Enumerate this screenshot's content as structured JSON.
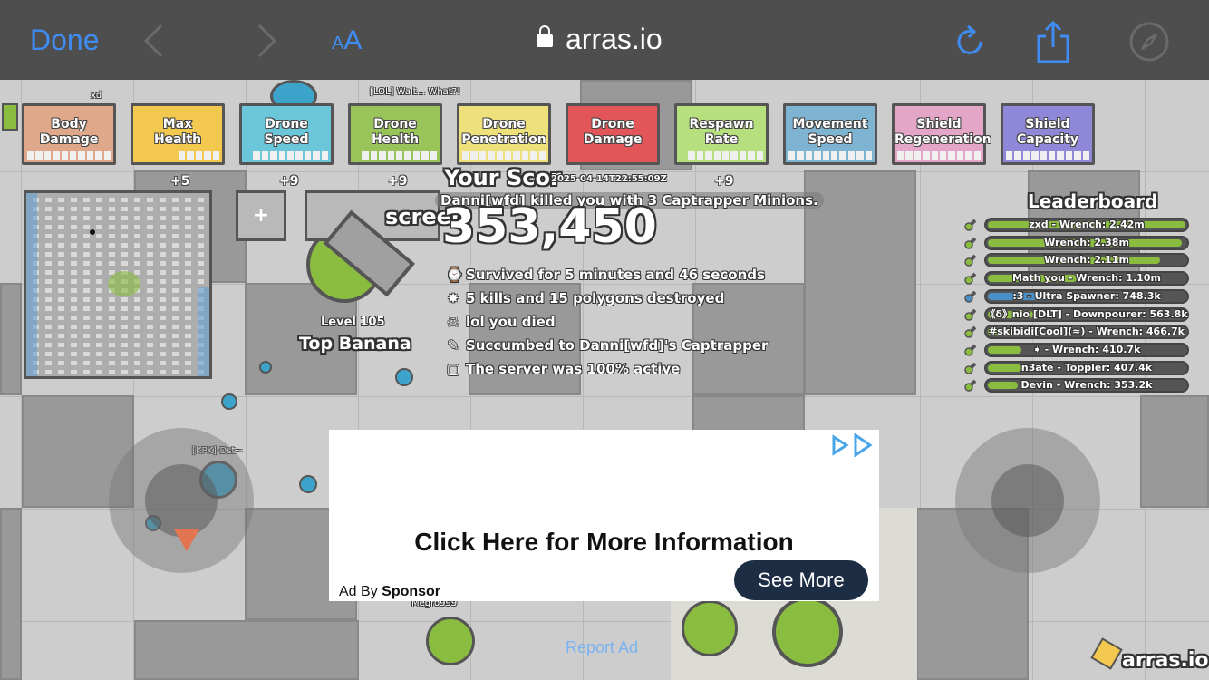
{
  "browser": {
    "done_label": "Done",
    "text_size_label_small": "A",
    "text_size_label_large": "A",
    "url": "arras.io",
    "accent_color": "#3f8cf2"
  },
  "stats": [
    {
      "label_1": "Body",
      "label_2": "Damage",
      "color": "#e0a88a",
      "filled": 0,
      "total": 10
    },
    {
      "label_1": "Max",
      "label_2": "Health",
      "color": "#f3c84e",
      "filled": 5,
      "total": 10,
      "plus": "+5"
    },
    {
      "label_1": "Drone",
      "label_2": "Speed",
      "color": "#6cc6da",
      "filled": 1,
      "total": 10,
      "plus": "+9"
    },
    {
      "label_1": "Drone",
      "label_2": "Health",
      "color": "#98c45a",
      "filled": 1,
      "total": 10,
      "plus": "+9"
    },
    {
      "label_1": "Drone",
      "label_2": "Penetration",
      "color": "#eee07a",
      "filled": 0,
      "total": 10
    },
    {
      "label_1": "Drone",
      "label_2": "Damage",
      "color": "#e25559",
      "filled": 10,
      "total": 10
    },
    {
      "label_1": "Respawn",
      "label_2": "Rate",
      "color": "#b6e07e",
      "filled": 1,
      "total": 10,
      "plus": "+9"
    },
    {
      "label_1": "Movement",
      "label_2": "Speed",
      "color": "#7eb3d2",
      "filled": 0,
      "total": 10
    },
    {
      "label_1": "Shield",
      "label_2": "Regeneration",
      "color": "#e3a6c6",
      "filled": 0,
      "total": 10
    },
    {
      "label_1": "Shield",
      "label_2": "Capacity",
      "color": "#8f87d8",
      "filled": 0,
      "total": 10
    }
  ],
  "death": {
    "score_label": "Your Scor",
    "timestamp": "2025-04-14T22:55:09Z",
    "killer_text": "Danni[wfd] killed you with 3 Captrapper Minions.",
    "score": "353,450",
    "lines": [
      {
        "icon": "stopwatch-icon",
        "glyph": "⌚",
        "text": "Survived for 5 minutes and 46 seconds"
      },
      {
        "icon": "explosion-icon",
        "glyph": "✸",
        "text": "5 kills and 15 polygons destroyed"
      },
      {
        "icon": "skull-icon",
        "glyph": "☠",
        "text": "lol you died"
      },
      {
        "icon": "knife-icon",
        "glyph": "✎",
        "text": "Succumbed to Danni[wfd]'s Captrapper"
      },
      {
        "icon": "clipboard-icon",
        "glyph": "▢",
        "text": "The server was 100% active"
      }
    ],
    "screenshot_label_fragment": "screen"
  },
  "player": {
    "level": "Level 105",
    "tank_name": "Top Banana"
  },
  "leaderboard": {
    "title": "Leaderboard",
    "entries": [
      {
        "text": "zxd - Wrench: 2.42m",
        "fill": 1.0,
        "color": "#8abc3f"
      },
      {
        "text": "Wrench: 2.38m",
        "fill": 0.98,
        "color": "#8abc3f"
      },
      {
        "text": "Wrench: 2.11m",
        "fill": 0.87,
        "color": "#8abc3f"
      },
      {
        "text": "Math you - Wrench: 1.10m",
        "fill": 0.45,
        "color": "#8abc3f"
      },
      {
        "text": ":3 - Ultra Spawner: 748.3k",
        "fill": 0.31,
        "color": "#4a90c8"
      },
      {
        "text": "《δ》nio [DLT] - Downpourer: 563.8k",
        "fill": 0.23,
        "color": "#8abc3f"
      },
      {
        "text": "#skibidi[Cool](≈) - Wrench: 466.7k",
        "fill": 0.19,
        "color": "#8abc3f"
      },
      {
        "text": "➧ - Wrench: 410.7k",
        "fill": 0.17,
        "color": "#8abc3f"
      },
      {
        "text": "n3ate - Toppler: 407.4k",
        "fill": 0.17,
        "color": "#8abc3f"
      },
      {
        "text": "Devin - Wrench: 353.2k",
        "fill": 0.15,
        "color": "#8abc3f"
      }
    ]
  },
  "name_tags": [
    "xd",
    "[LOL] Wait... What?!",
    "[KPK]-Dst~",
    "Megro999"
  ],
  "ad": {
    "headline": "Click Here for More Information",
    "by_label": "Ad By",
    "sponsor": "Sponsor",
    "cta": "See More",
    "report": "Report Ad"
  },
  "brand": "arras.io"
}
